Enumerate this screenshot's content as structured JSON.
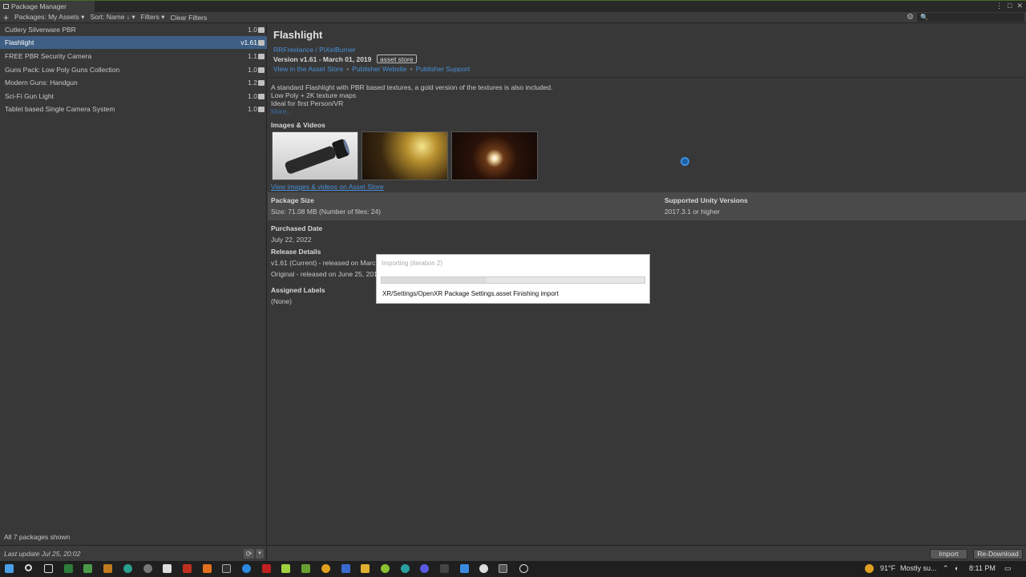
{
  "window": {
    "title": "Package Manager"
  },
  "toolbar": {
    "plus": "+",
    "packages": "Packages: My Assets ▾",
    "sort": "Sort: Name ↓ ▾",
    "filters": "Filters ▾",
    "clear": "Clear Filters",
    "search_placeholder": "🔍"
  },
  "packages": [
    {
      "name": "Cutlery Silverware PBR",
      "version": "1.0"
    },
    {
      "name": "Flashlight",
      "version": "v1.61"
    },
    {
      "name": "FREE PBR Security Camera",
      "version": "1.1"
    },
    {
      "name": "Guns Pack: Low Poly Guns Collection",
      "version": "1.0"
    },
    {
      "name": "Modern Guns: Handgun",
      "version": "1.2"
    },
    {
      "name": "Sci-Fi Gun Light",
      "version": "1.0"
    },
    {
      "name": "Tablet based Single Camera System",
      "version": "1.0"
    }
  ],
  "package_count": "All 7 packages shown",
  "last_update": "Last update Jul 25, 20:02",
  "detail": {
    "title": "Flashlight",
    "author": "RRFreelance / PiXelBurner",
    "version_line": "Version v1.61 - March 01, 2019",
    "badge": "asset store",
    "link_store": "View in the Asset Store",
    "link_website": "Publisher Website",
    "link_support": "Publisher Support",
    "desc1": "A standard Flashlight with PBR based textures, a gold version of the textures is also included.",
    "desc2": "Low Poly + 2K texture maps",
    "desc3": "Ideal for first Person/VR",
    "more": "More...",
    "images_header": "Images & Videos",
    "images_link": "View images & videos on Asset Store",
    "size_header": "Package Size",
    "size_value": "Size: 71.08 MB (Number of files: 24)",
    "unity_header": "Supported Unity Versions",
    "unity_value": "2017.3.1 or higher",
    "purchased_header": "Purchased Date",
    "purchased_value": "July 22, 2022",
    "release_header": "Release Details",
    "release_current": "v1.61 (Current) - released on March",
    "release_original": "Original - released on June 25, 201",
    "labels_header": "Assigned Labels",
    "labels_value": "(None)"
  },
  "dialog": {
    "title": "Importing (iteration 2)",
    "message": "XR/Settings/OpenXR Package Settings.asset Finishing import",
    "progress": 0.4
  },
  "buttons": {
    "import": "Import",
    "redownload": "Re-Download"
  },
  "taskbar": {
    "weather": "91°F",
    "weather_desc": "Mostly su...",
    "time": "8:11 PM"
  },
  "colors": {
    "selection": "#3e5f83",
    "link": "#4a8fd6",
    "accent": "#3b8ee0"
  }
}
